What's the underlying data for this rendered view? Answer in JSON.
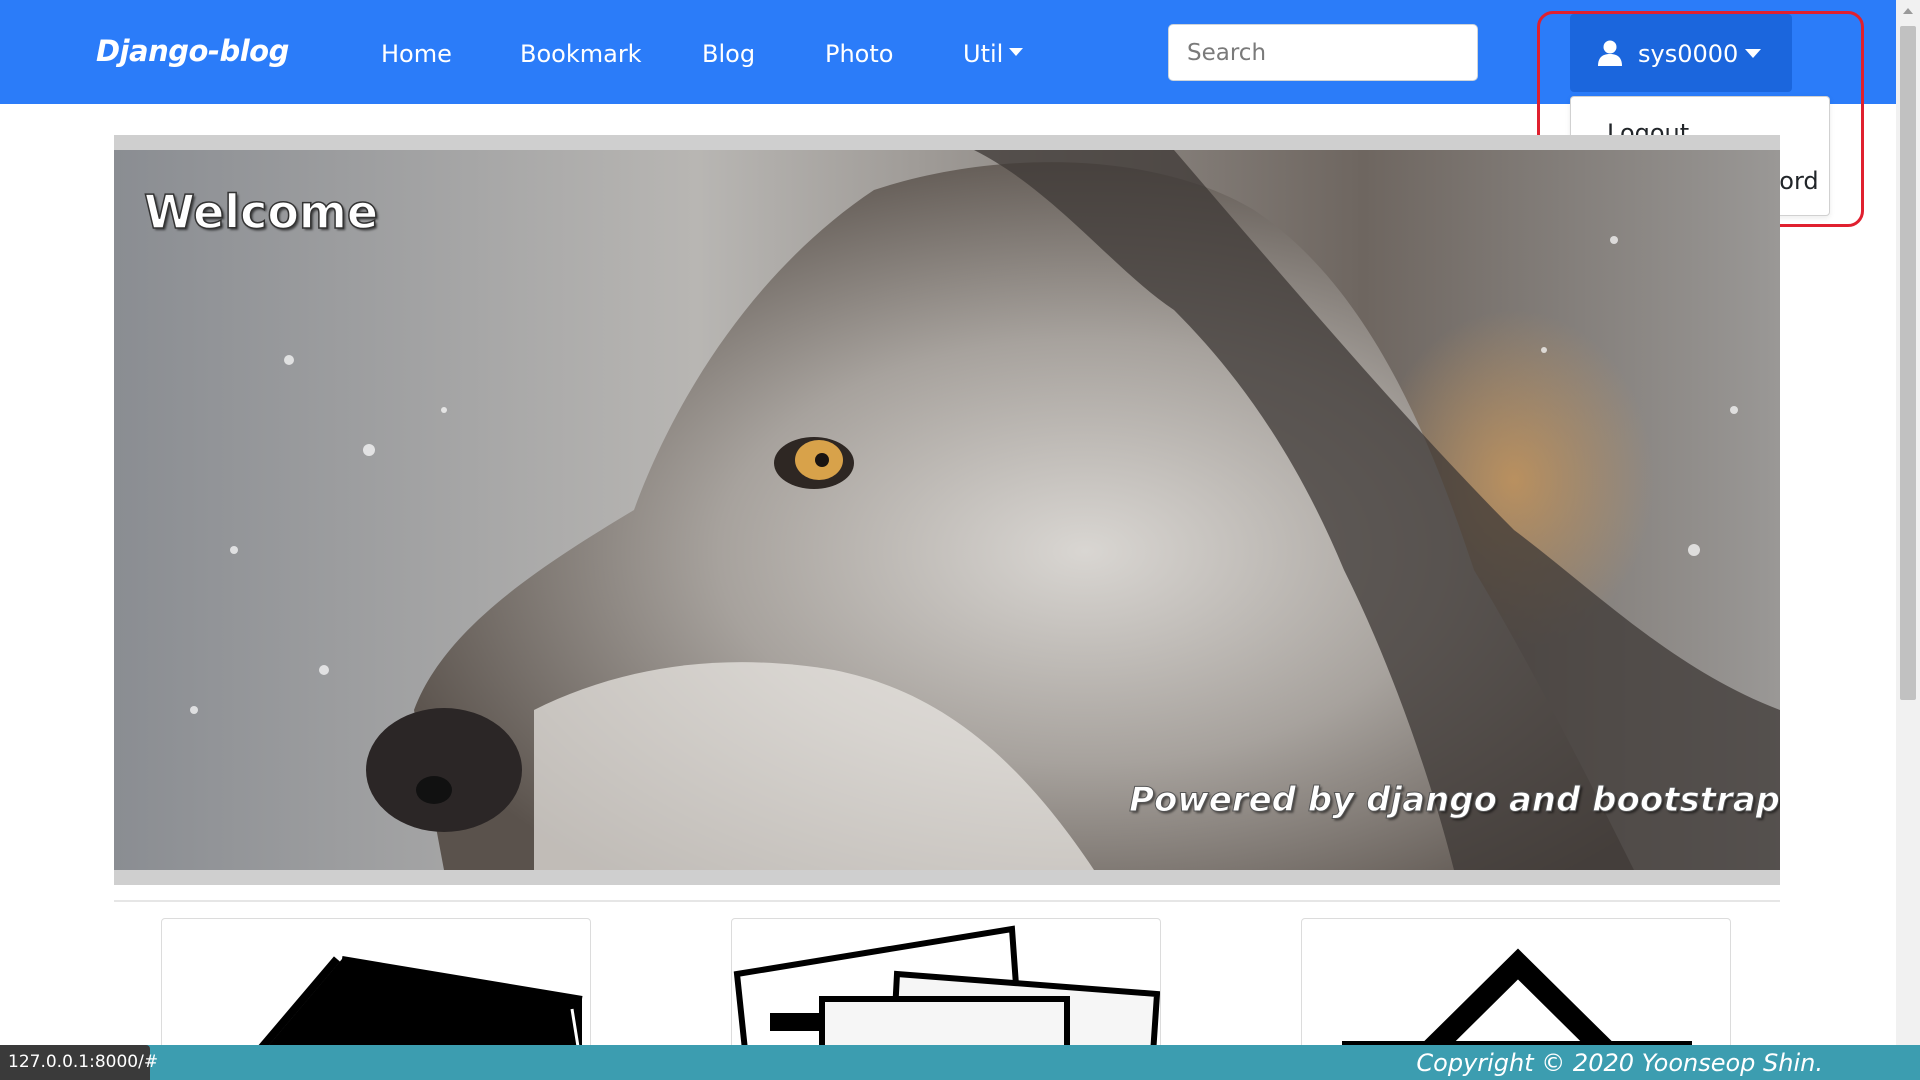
{
  "navbar": {
    "brand": "Django-blog",
    "links": [
      "Home",
      "Bookmark",
      "Blog",
      "Photo",
      "Util"
    ],
    "search_placeholder": "Search",
    "user": "sys0000",
    "dropdown": [
      "Logout",
      "Change Password"
    ]
  },
  "hero": {
    "title": "Welcome",
    "caption": "Powered by django and bootstrap"
  },
  "cards": [
    "bookmark-icon",
    "photo-icon",
    "home-icon"
  ],
  "footer": {
    "copyright": "Copyright © 2020 Yoonseop Shin."
  },
  "status_url": "127.0.0.1:8000/#",
  "colors": {
    "navbar": "#2b7cf9",
    "user_button": "#1b66dd",
    "footer": "#3c9db0",
    "highlight": "#e0202f"
  }
}
